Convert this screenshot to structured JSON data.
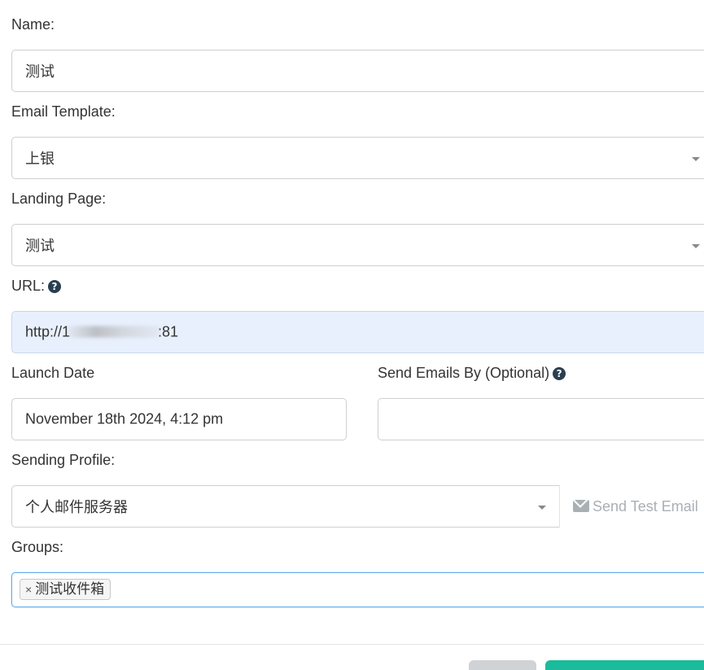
{
  "form": {
    "name": {
      "label": "Name:",
      "value": "测试"
    },
    "email_template": {
      "label": "Email Template:",
      "value": "上银"
    },
    "landing_page": {
      "label": "Landing Page:",
      "value": "测试"
    },
    "url": {
      "label": "URL:",
      "value_prefix": "http://1",
      "value_suffix": ":81"
    },
    "launch_date": {
      "label": "Launch Date",
      "value": "November 18th 2024, 4:12 pm"
    },
    "send_by": {
      "label": "Send Emails By (Optional)",
      "value": ""
    },
    "sending_profile": {
      "label": "Sending Profile:",
      "value": "个人邮件服务器",
      "test_button": "Send Test Email"
    },
    "groups": {
      "label": "Groups:",
      "tags": [
        {
          "remove": "×",
          "label": "测试收件箱"
        }
      ]
    }
  },
  "icons": {
    "help": "question-circle-icon",
    "dropdown": "caret-down-icon",
    "mail": "envelope-icon",
    "remove": "close-icon"
  },
  "colors": {
    "primary_button": "#1abc9c",
    "secondary_button": "#cfd3d6",
    "url_field_bg": "#e8f0fe",
    "focus_border": "#66afe9",
    "help_icon": "#283f50"
  }
}
